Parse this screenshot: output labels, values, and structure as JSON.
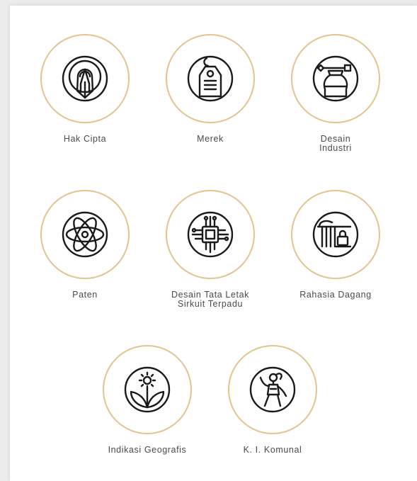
{
  "colors": {
    "ring": "#e2c48f",
    "icon": "#1a1a1a",
    "label": "#4a4a4a",
    "card": "#ffffff",
    "background": "#ececec"
  },
  "categories": [
    {
      "label_1": "Hak Cipta",
      "label_2": "",
      "icon": "copyright-pen-icon"
    },
    {
      "label_1": "Merek",
      "label_2": "",
      "icon": "tag-icon"
    },
    {
      "label_1": "Desain",
      "label_2": "Industri",
      "icon": "bottle-icon"
    },
    {
      "label_1": "Paten",
      "label_2": "",
      "icon": "atom-icon"
    },
    {
      "label_1": "Desain Tata Letak",
      "label_2": "Sirkuit Terpadu",
      "icon": "microchip-icon"
    },
    {
      "label_1": "Rahasia Dagang",
      "label_2": "",
      "icon": "store-lock-icon"
    },
    {
      "label_1": "Indikasi Geografis",
      "label_2": "",
      "icon": "sun-plant-icon"
    },
    {
      "label_1": "K. I. Komunal",
      "label_2": "",
      "icon": "dancer-icon"
    }
  ]
}
